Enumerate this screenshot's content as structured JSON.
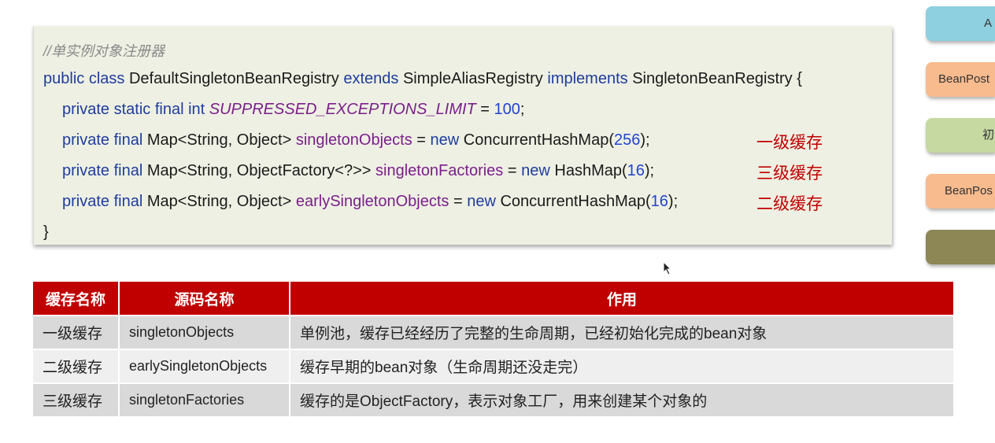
{
  "code": {
    "comment": "//单实例对象注册器",
    "class_decl": {
      "kw1": "public class",
      "name": "DefaultSingletonBeanRegistry",
      "kw2": "extends",
      "parent": "SimpleAliasRegistry",
      "kw3": "implements",
      "iface": "SingletonBeanRegistry",
      "brace": "{"
    },
    "line1": {
      "kw": "private static final int",
      "field": "SUPPRESSED_EXCEPTIONS_LIMIT",
      "eq": " = ",
      "num": "100",
      "end": ";"
    },
    "line2": {
      "kw": "private final",
      "type": "Map<String, Object>",
      "field": "singletonObjects",
      "eq": " = ",
      "kw2": "new",
      "ctor": "ConcurrentHashMap(",
      "num": "256",
      "end": ");",
      "note": "一级缓存"
    },
    "line3": {
      "kw": "private final",
      "type": "Map<String, ObjectFactory<?>>",
      "field": "singletonFactories",
      "eq": " = ",
      "kw2": "new",
      "ctor": "HashMap(",
      "num": "16",
      "end": ");",
      "note": "三级缓存"
    },
    "line4": {
      "kw": "private final",
      "type": "Map<String, Object>",
      "field": "earlySingletonObjects",
      "eq": " = ",
      "kw2": "new",
      "ctor": "ConcurrentHashMap(",
      "num": "16",
      "end": ");",
      "note": "二级缓存"
    },
    "close": "}"
  },
  "side_boxes": [
    {
      "label": "A",
      "color": "#8ecfe0"
    },
    {
      "label": "BeanPost",
      "color": "#f8bb8e"
    },
    {
      "label": "初",
      "color": "#c5d9a0"
    },
    {
      "label": "BeanPos",
      "color": "#f8bb8e"
    },
    {
      "label": "",
      "color": "#8c8755"
    }
  ],
  "table": {
    "headers": [
      "缓存名称",
      "源码名称",
      "作用"
    ],
    "rows": [
      [
        "一级缓存",
        "singletonObjects",
        "单例池，缓存已经经历了完整的生命周期，已经初始化完成的bean对象"
      ],
      [
        "二级缓存",
        "earlySingletonObjects",
        "缓存早期的bean对象（生命周期还没走完）"
      ],
      [
        "三级缓存",
        "singletonFactories",
        "缓存的是ObjectFactory，表示对象工厂，用来创建某个对象的"
      ]
    ]
  }
}
